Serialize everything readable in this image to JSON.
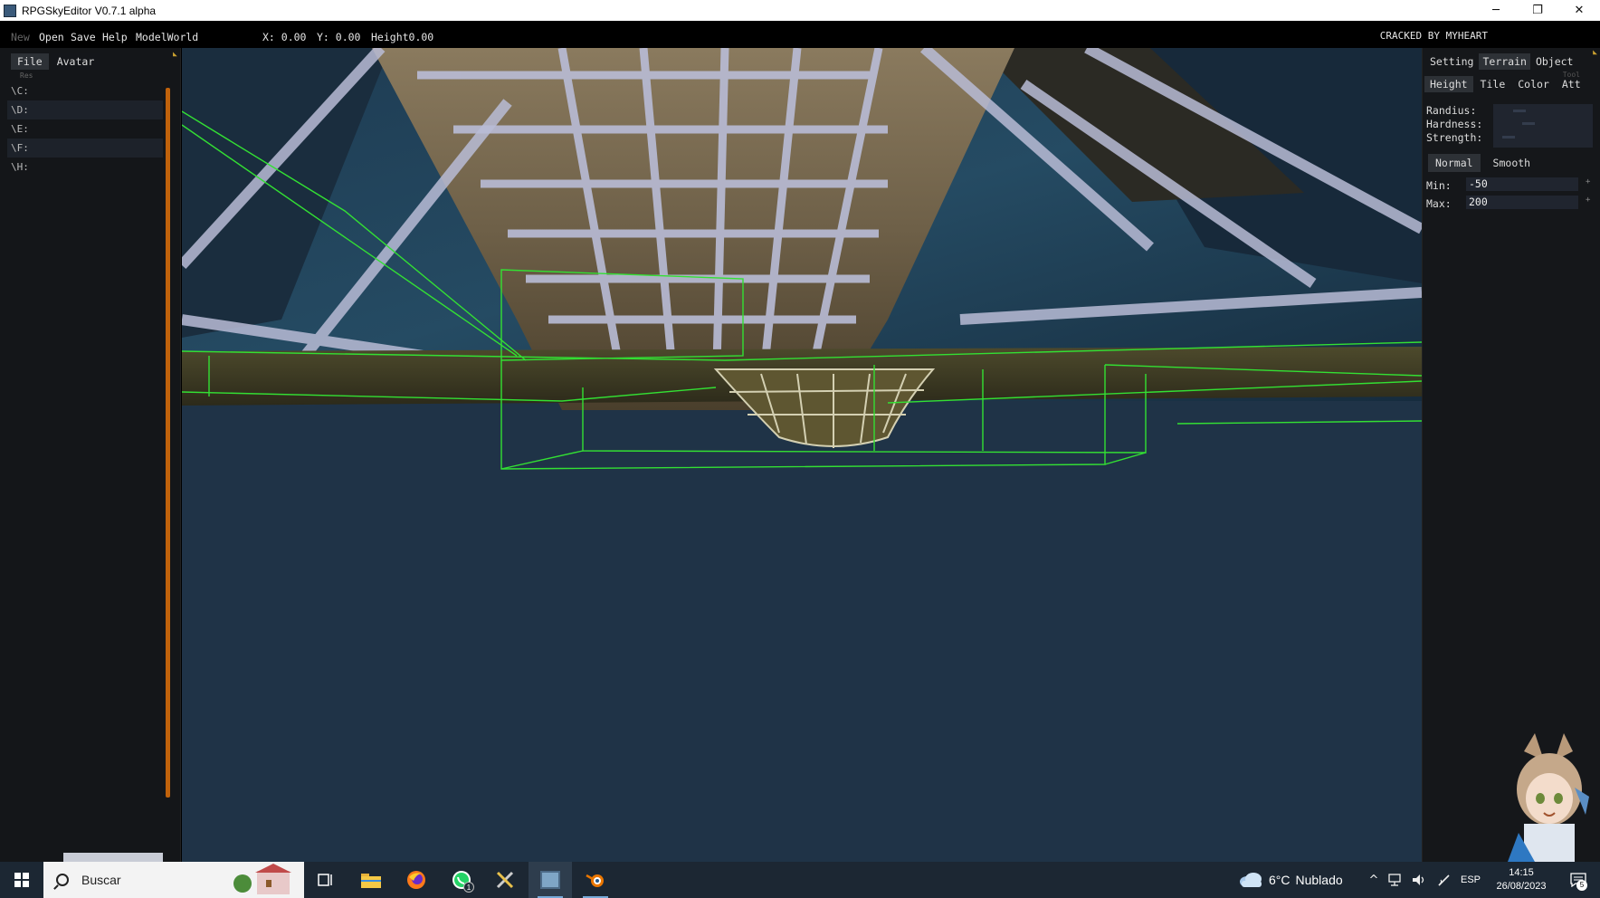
{
  "window": {
    "title": "RPGSkyEditor V0.7.1 alpha",
    "minimize_glyph": "─",
    "maximize_glyph": "❐",
    "close_glyph": "✕"
  },
  "menu": {
    "new": "New",
    "open": "Open",
    "save": "Save",
    "help": "Help",
    "model_world": "ModelWorld",
    "coord_x": "X: 0.00",
    "coord_y": "Y: 0.00",
    "height": "Height0.00",
    "credit": "CRACKED BY MYHEART"
  },
  "left_panel": {
    "tabs": [
      "File",
      "Avatar"
    ],
    "active_tab": "File",
    "sub_label": "Res",
    "drives": [
      "\\C:",
      "\\D:",
      "\\E:",
      "\\F:",
      "\\H:"
    ]
  },
  "right_panel": {
    "tabs": [
      "Setting",
      "Terrain",
      "Object"
    ],
    "active_tab": "Terrain",
    "subtabs": [
      "Height",
      "Tile",
      "Color",
      "Att"
    ],
    "active_subtab": "Height",
    "faint_label": "Tool",
    "brush": {
      "radius_label": "Randius:",
      "hardness_label": "Hardness:",
      "strength_label": "Strength:"
    },
    "modes": [
      "Normal",
      "Smooth"
    ],
    "active_mode": "Normal",
    "min_label": "Min:",
    "min_value": "-50",
    "max_label": "Max:",
    "max_value": "200",
    "plus_glyph": "+"
  },
  "taskbar": {
    "search_text": "Buscar",
    "weather_temp": "6°C",
    "weather_desc": "Nublado",
    "whatsapp_badge": "1",
    "language": "ESP",
    "time": "14:15",
    "date": "26/08/2023",
    "notifications": "5",
    "tray_up_glyph": "^"
  },
  "colors": {
    "wireframe": "#33e033",
    "accent_orange": "#c0620b",
    "viewport_bg": "#1f3347",
    "panel_bg": "#141619"
  }
}
